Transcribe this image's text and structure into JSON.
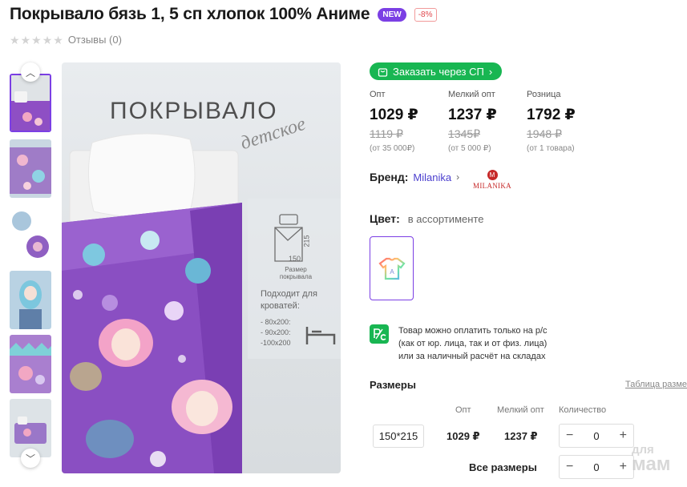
{
  "product": {
    "title": "Покрывало бязь 1, 5 сп хлопок 100% Аниме",
    "badge_new": "NEW",
    "badge_discount": "-8%",
    "rating": 0,
    "reviews_label": "Отзывы (0)"
  },
  "gallery": {
    "main_overlay": {
      "heading": "ПОКРЫВАЛО",
      "script": "детское",
      "size_w": "150",
      "size_h": "215",
      "size_caption_1": "Размер",
      "size_caption_2": "покрывала",
      "beds_heading_1": "Подходит для",
      "beds_heading_2": "кроватей:",
      "beds": [
        "- 80x200:",
        "- 90x200:",
        "-100x200"
      ]
    }
  },
  "order_button": {
    "label": "Заказать через СП"
  },
  "prices": [
    {
      "label": "Опт",
      "value": "1029 ₽",
      "old": "1119 ₽",
      "note": "(от 35 000₽)"
    },
    {
      "label": "Мелкий опт",
      "value": "1237 ₽",
      "old": "1345₽",
      "note": "(от 5 000 ₽)"
    },
    {
      "label": "Розница",
      "value": "1792 ₽",
      "old": "1948 ₽",
      "note": "(от 1 товара)"
    }
  ],
  "brand": {
    "label": "Бренд:",
    "name": "Milanika",
    "logo_letter": "M",
    "logo_text": "MILANIKA"
  },
  "color": {
    "label": "Цвет:",
    "value": "в ассортименте"
  },
  "payment": {
    "icon_text": "P/C",
    "lines": [
      "Товар можно оплатить только на р/с",
      "(как от юр. лица, так и от физ. лица)",
      "или за наличный расчёт на складах"
    ]
  },
  "sizes": {
    "title": "Размеры",
    "table_link": "Таблица разме",
    "headers": {
      "opt": "Опт",
      "small_opt": "Мелкий опт",
      "qty": "Количество"
    },
    "rows": [
      {
        "size": "150*215",
        "opt": "1029 ₽",
        "small_opt": "1237 ₽",
        "qty": "0"
      }
    ],
    "all_label": "Все размеры",
    "all_qty": "0"
  },
  "watermark": {
    "line1": "для",
    "line2": "мам"
  },
  "colors": {
    "accent": "#7b3fe4",
    "green": "#18b652",
    "discount": "#e0474c",
    "brand_red": "#c62828"
  }
}
